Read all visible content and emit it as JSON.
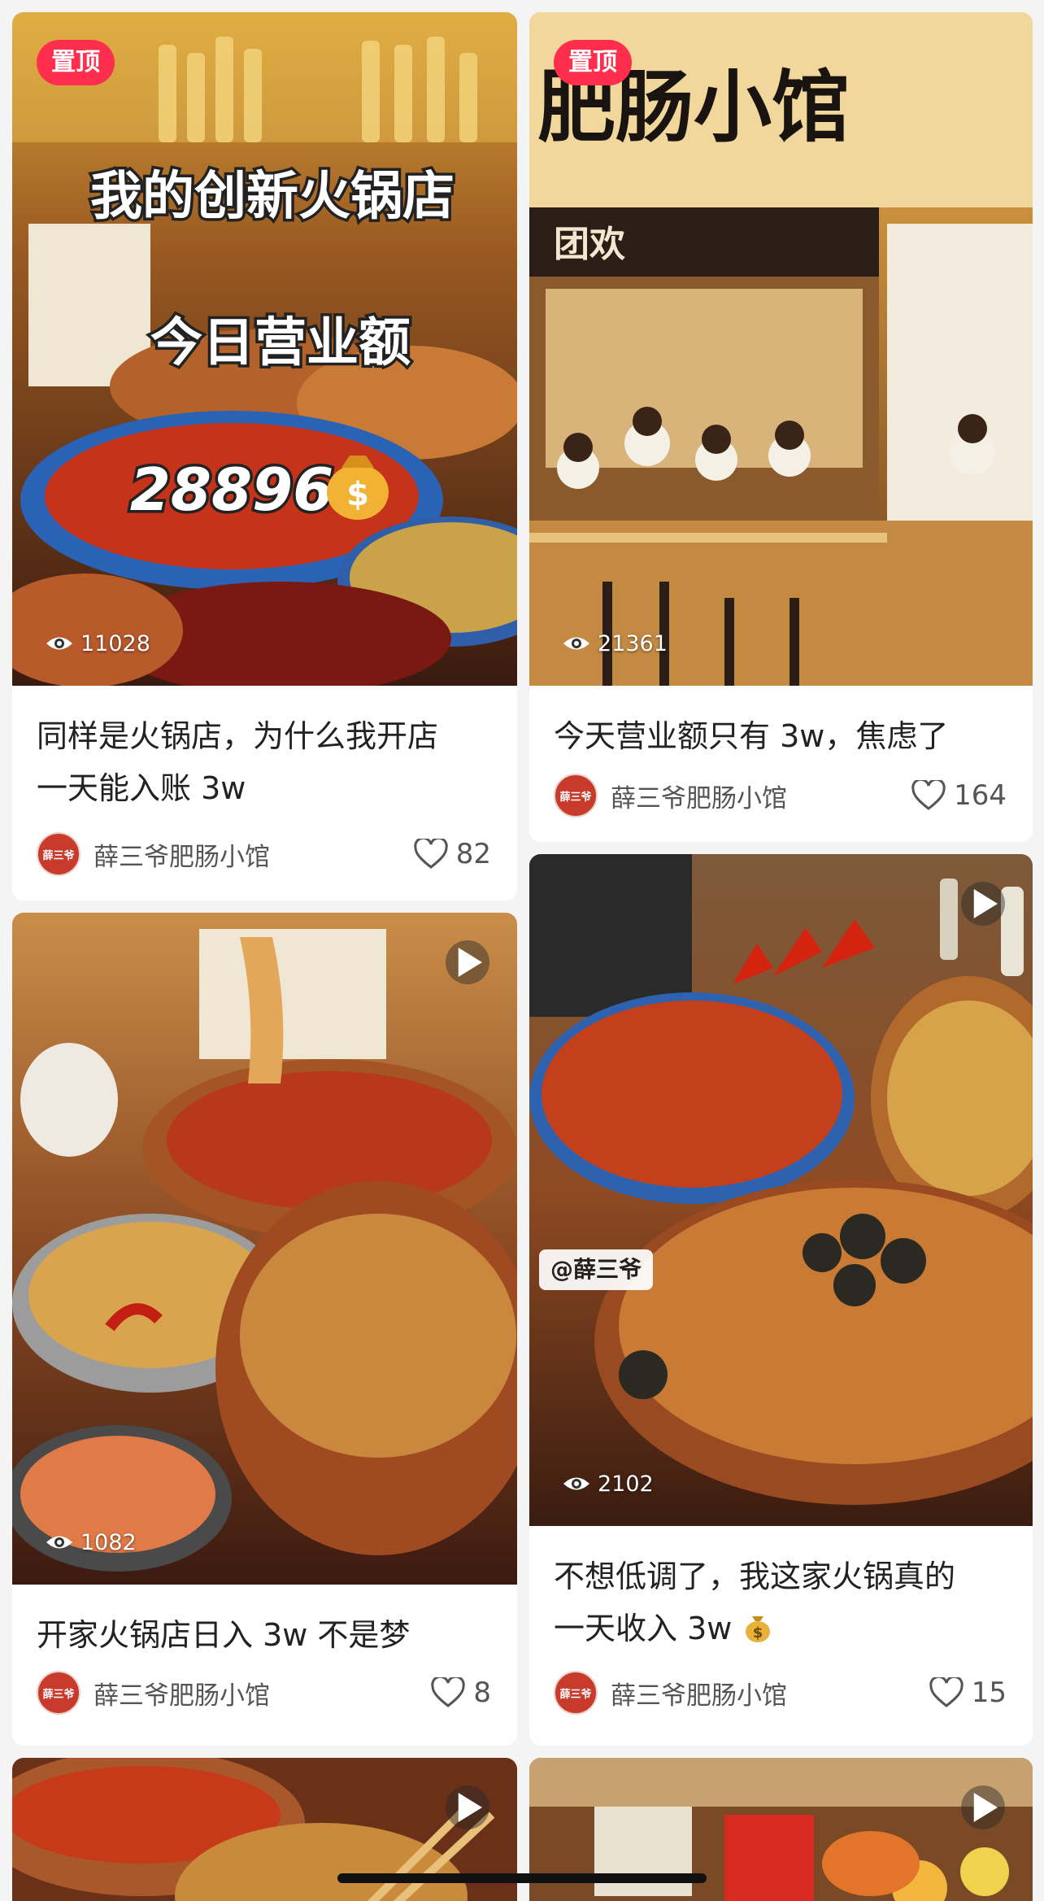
{
  "feed": {
    "cards": [
      {
        "pinned_label": "置顶",
        "cover_overlay": {
          "line1": "我的创新火锅店",
          "line2": "今日营业额",
          "line3": "28896"
        },
        "views": "11028",
        "title_line1": "同样是火锅店，为什么我开店",
        "title_line2": "一天能入账 3w",
        "author": "薛三爷肥肠小馆",
        "avatar_text": "薛三爷",
        "likes": "82",
        "cover_icon": "money-bag-icon"
      },
      {
        "pinned_label": "置顶",
        "cover_overlay": {
          "sign": "肥肠小馆",
          "menu1": "团欢"
        },
        "views": "21361",
        "title_line1": "今天营业额只有 3w，焦虑了",
        "author": "薛三爷肥肠小馆",
        "avatar_text": "薛三爷",
        "likes": "164"
      },
      {
        "views": "1082",
        "title_line1": "开家火锅店日入 3w 不是梦",
        "author": "薛三爷肥肠小馆",
        "avatar_text": "薛三爷",
        "likes": "8",
        "has_video": true
      },
      {
        "watermark": "@薛三爷",
        "views": "2102",
        "title_line1": "不想低调了，我这家火锅真的",
        "title_line2": "一天收入 3w",
        "title_emoji": "money-bag-icon",
        "author": "薛三爷肥肠小馆",
        "avatar_text": "薛三爷",
        "likes": "15",
        "has_video": true
      },
      {
        "has_video": true
      },
      {
        "has_video": true
      }
    ]
  },
  "colors": {
    "pinned_badge": "#ff2e4d",
    "background": "#f4f4f4",
    "avatar": "#c73a2c",
    "text_primary": "#222222",
    "text_secondary": "#555555"
  }
}
